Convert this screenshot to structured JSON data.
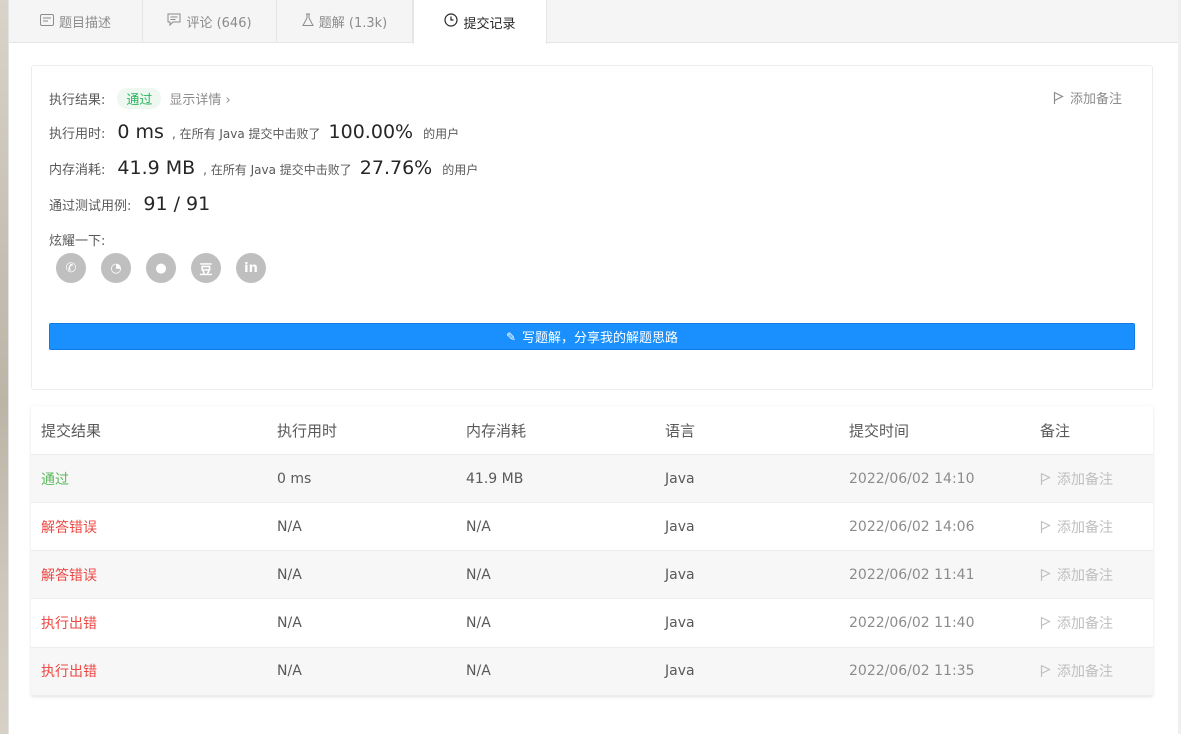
{
  "tabs": [
    {
      "label": "题目描述",
      "icon": "description-icon"
    },
    {
      "label": "评论 (646)",
      "icon": "comment-icon"
    },
    {
      "label": "题解 (1.3k)",
      "icon": "flask-icon"
    },
    {
      "label": "提交记录",
      "icon": "clock-icon"
    }
  ],
  "result": {
    "status_label": "执行结果:",
    "status_value": "通过",
    "detail_link": "显示详情 ›",
    "add_note": "添加备注",
    "runtime_label": "执行用时:",
    "runtime_value": "0 ms",
    "runtime_text": ", 在所有 Java 提交中击败了",
    "runtime_percent": "100.00%",
    "runtime_suffix": "的用户",
    "memory_label": "内存消耗:",
    "memory_value": "41.9 MB",
    "memory_text": ", 在所有 Java 提交中击败了",
    "memory_percent": "27.76%",
    "memory_suffix": "的用户",
    "testcases_label": "通过测试用例:",
    "testcases_value": "91 / 91",
    "share_label": "炫耀一下:",
    "share_icons": [
      {
        "name": "wechat-icon",
        "glyph": "✆"
      },
      {
        "name": "weibo-icon",
        "glyph": "◔"
      },
      {
        "name": "qq-icon",
        "glyph": "●"
      },
      {
        "name": "douban-icon",
        "glyph": "豆"
      },
      {
        "name": "linkedin-icon",
        "glyph": "in"
      }
    ],
    "write_solution_button": "写题解，分享我的解题思路"
  },
  "table": {
    "headers": [
      "提交结果",
      "执行用时",
      "内存消耗",
      "语言",
      "提交时间",
      "备注"
    ],
    "rows": [
      {
        "status": "通过",
        "status_type": "pass",
        "runtime": "0 ms",
        "memory": "41.9 MB",
        "language": "Java",
        "time": "2022/06/02 14:10",
        "note": "添加备注"
      },
      {
        "status": "解答错误",
        "status_type": "fail",
        "runtime": "N/A",
        "memory": "N/A",
        "language": "Java",
        "time": "2022/06/02 14:06",
        "note": "添加备注"
      },
      {
        "status": "解答错误",
        "status_type": "fail",
        "runtime": "N/A",
        "memory": "N/A",
        "language": "Java",
        "time": "2022/06/02 11:41",
        "note": "添加备注"
      },
      {
        "status": "执行出错",
        "status_type": "fail",
        "runtime": "N/A",
        "memory": "N/A",
        "language": "Java",
        "time": "2022/06/02 11:40",
        "note": "添加备注"
      },
      {
        "status": "执行出错",
        "status_type": "fail",
        "runtime": "N/A",
        "memory": "N/A",
        "language": "Java",
        "time": "2022/06/02 11:35",
        "note": "添加备注"
      }
    ]
  },
  "colors": {
    "accent": "#1a90ff",
    "pass": "#5cb85c",
    "fail": "#ef4743"
  }
}
